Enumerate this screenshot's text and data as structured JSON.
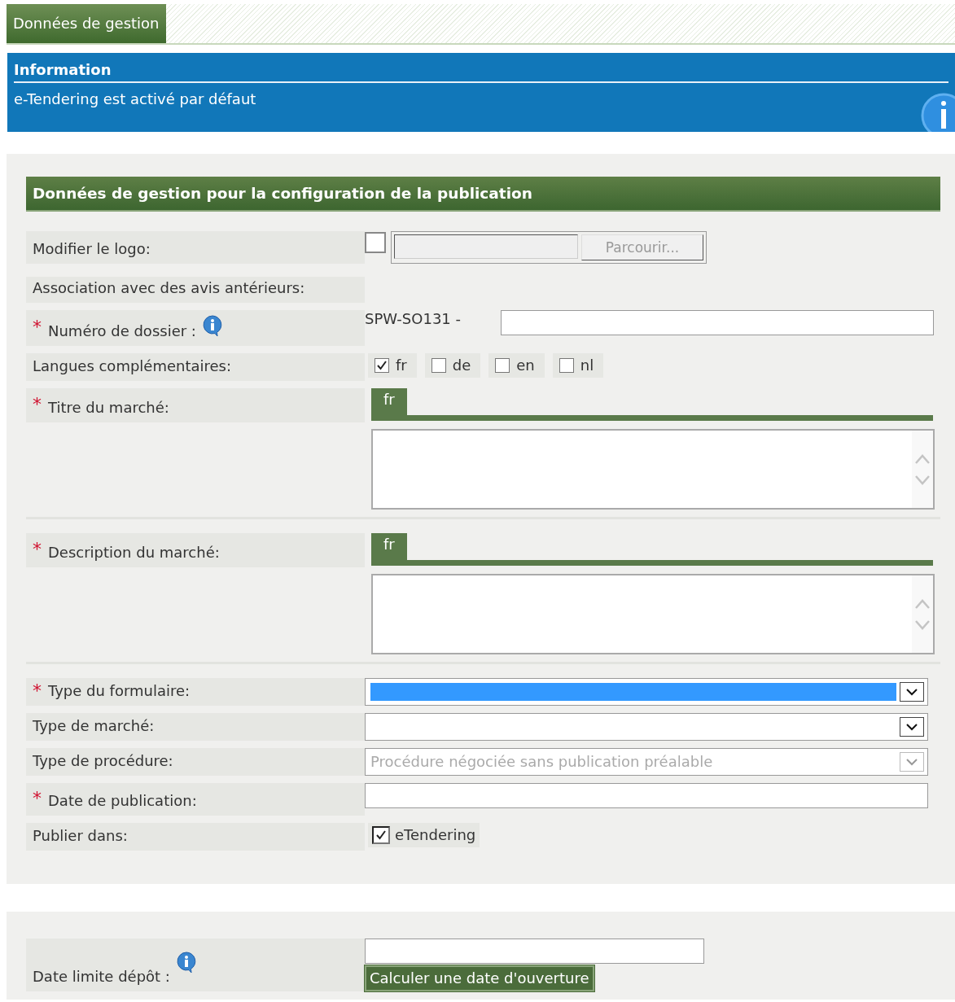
{
  "tab": {
    "label": "Données de gestion",
    "selected": true
  },
  "info": {
    "title": "Information",
    "message": "e-Tendering est activé par défaut"
  },
  "section": {
    "title": "Données de gestion pour la configuration de la publication",
    "rows": [
      {
        "kind": "file",
        "label": "Modifier le logo:",
        "checked": false,
        "button": "Parcourir..."
      },
      {
        "kind": "plain",
        "label": "Association avec des avis antérieurs:"
      },
      {
        "kind": "prefix",
        "label": "Numéro de dossier :",
        "required_mark": "*",
        "info": true,
        "prefix": "SPW-SO131 -"
      },
      {
        "kind": "languages",
        "label": "Langues complémentaires:",
        "options": [
          {
            "label": "fr",
            "checked": true
          },
          {
            "label": "de",
            "checked": false
          },
          {
            "label": "en",
            "checked": false
          },
          {
            "label": "nl",
            "checked": false
          }
        ]
      },
      {
        "kind": "multilang",
        "label": "Titre du marché:",
        "required_mark": "*",
        "tabs": [
          {
            "label": "fr",
            "selected": true
          }
        ]
      },
      {
        "kind": "multilang",
        "label": "Description du marché:",
        "required_mark": "*",
        "tabs": [
          {
            "label": "fr",
            "selected": true
          }
        ]
      },
      {
        "kind": "select",
        "label": "Type du formulaire:",
        "required_mark": "*",
        "highlighted": true,
        "disabled": false
      },
      {
        "kind": "select",
        "label": "Type de marché:",
        "highlighted": false,
        "disabled": false
      },
      {
        "kind": "select",
        "label": "Type de procédure:",
        "highlighted": false,
        "disabled": true,
        "value": "Procédure négociée sans publication préalable"
      },
      {
        "kind": "input",
        "label": "Date de publication:",
        "required_mark": "*"
      },
      {
        "kind": "checkbox",
        "label": "Publier dans:",
        "option": {
          "label": "eTendering",
          "checked": true
        }
      }
    ]
  },
  "deadline": {
    "label": "Date limite dépôt :",
    "info": true,
    "button": "Calculer une date d'ouverture"
  }
}
